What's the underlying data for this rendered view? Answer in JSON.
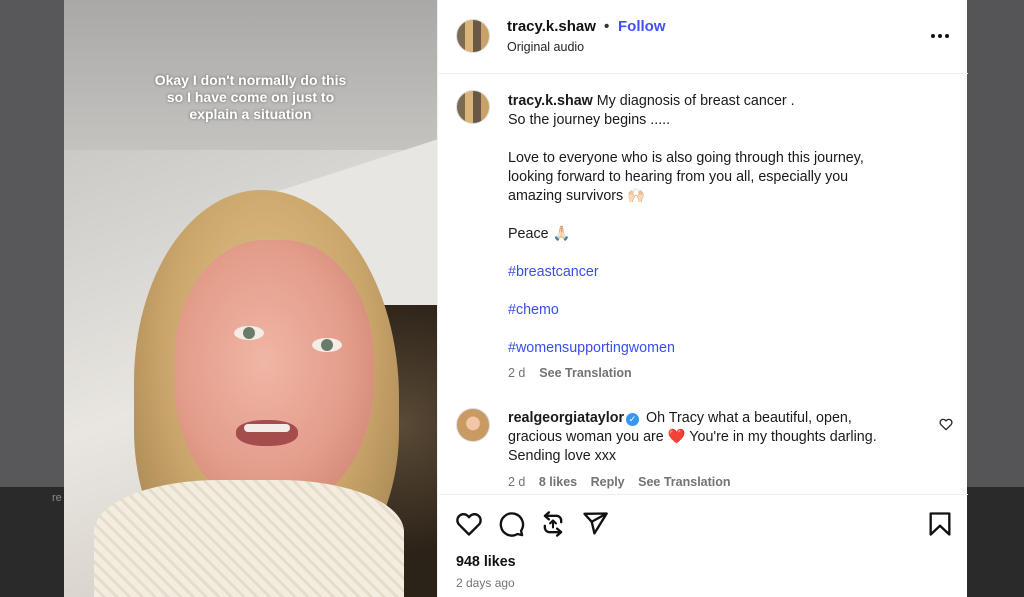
{
  "background": {
    "faded_text": "re"
  },
  "video": {
    "caption_lines": [
      "Okay I don't normally do this",
      "so I have come on just to",
      "explain a situation"
    ]
  },
  "header": {
    "username": "tracy.k.shaw",
    "separator": "•",
    "follow_label": "Follow",
    "audio_label": "Original audio",
    "more_icon": "more-horizontal-icon"
  },
  "post": {
    "username": "tracy.k.shaw",
    "line1": "My diagnosis of breast cancer .",
    "line2": "So the journey begins .....",
    "line3": "Love to everyone who is also going through this journey,",
    "line4": "looking forward to hearing from you all, especially you",
    "line5": "amazing survivors 🙌🏻",
    "line6": "Peace 🙏🏻",
    "tags": [
      "#breastcancer",
      "#chemo",
      "#womensupportingwomen"
    ],
    "time": "2 d",
    "translation_label": "See Translation"
  },
  "comment": {
    "username": "realgeorgiataylor",
    "verified": true,
    "line1": "Oh Tracy what a beautiful, open,",
    "line2a": "gracious woman you are",
    "heart": "❤️",
    "line2b": "You're in my thoughts darling.",
    "line3": "Sending love xxx",
    "time": "2 d",
    "likes": "8 likes",
    "reply_label": "Reply",
    "translation_label": "See Translation"
  },
  "actions": {
    "icons": [
      "heart-icon",
      "comment-icon",
      "repost-icon",
      "share-icon",
      "bookmark-icon"
    ],
    "likes_label": "948 likes",
    "time_ago": "2 days ago"
  },
  "colors": {
    "link": "#4150f7",
    "muted": "#737373",
    "divider": "#efefef",
    "backdrop": "#4d4d4f"
  }
}
